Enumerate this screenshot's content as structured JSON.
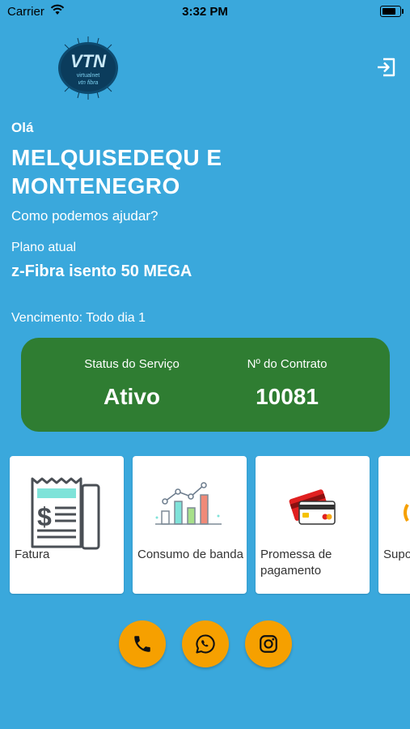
{
  "status_bar": {
    "carrier": "Carrier",
    "time": "3:32 PM",
    "battery_level": 0.9
  },
  "logo": {
    "line1": "VTN",
    "line2": "virtualnet",
    "line3": "vtn fibra"
  },
  "header": {
    "logout_icon": "logout-icon"
  },
  "greeting": {
    "hello": "Olá",
    "name": "MELQUISEDEQU E MONTENEGRO",
    "subtitle": "Como podemos ajudar?"
  },
  "plan": {
    "label": "Plano atual",
    "name": "z-Fibra isento 50 MEGA",
    "due": "Vencimento: Todo dia 1"
  },
  "status_card": {
    "color": "#2f7d32",
    "service_label": "Status do Serviço",
    "service_value": "Ativo",
    "contract_label": "Nº do Contrato",
    "contract_value": "10081"
  },
  "tiles": [
    {
      "label": "Fatura",
      "icon": "invoice-icon"
    },
    {
      "label": "Consumo de banda",
      "icon": "bar-chart-icon"
    },
    {
      "label": "Promessa de pagamento",
      "icon": "credit-cards-icon"
    },
    {
      "label": "Suporte",
      "icon": "support-icon"
    }
  ],
  "contact_buttons": [
    {
      "name": "phone",
      "icon": "phone-icon"
    },
    {
      "name": "whatsapp",
      "icon": "whatsapp-icon"
    },
    {
      "name": "instagram",
      "icon": "instagram-icon"
    }
  ],
  "colors": {
    "background": "#3aa8dc",
    "accent": "#f6a000"
  }
}
